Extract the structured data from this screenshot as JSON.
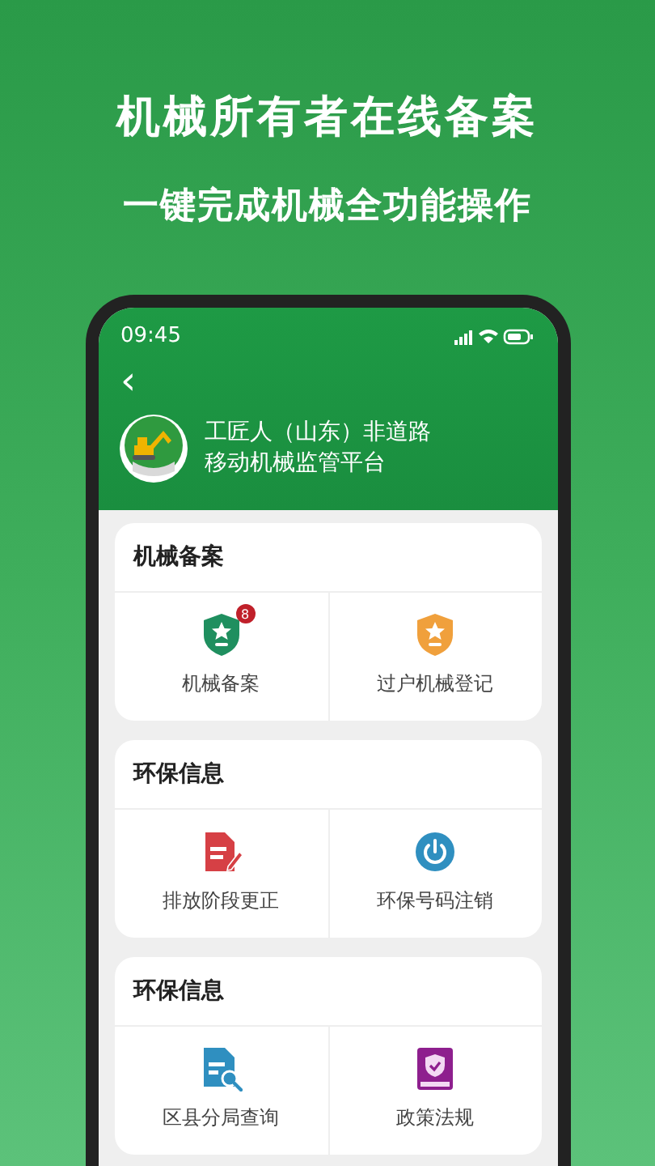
{
  "headline": "机械所有者在线备案",
  "subheadline": "一键完成机械全功能操作",
  "phone": {
    "status_bar": {
      "time": "09:45"
    },
    "header": {
      "back": "‹",
      "title_lines": [
        "工匠人（山东）非道路",
        "移动机械监管平台"
      ]
    },
    "sections": [
      {
        "title": "机械备案",
        "items": [
          {
            "kind": "shield-green",
            "label": "机械备案",
            "badge": "8"
          },
          {
            "kind": "shield-orange",
            "label": "过户机械登记"
          }
        ]
      },
      {
        "title": "环保信息",
        "items": [
          {
            "kind": "doc-edit",
            "label": "排放阶段更正"
          },
          {
            "kind": "power",
            "label": "环保号码注销"
          }
        ]
      },
      {
        "title": "环保信息",
        "items": [
          {
            "kind": "doc-search",
            "label": "区县分局查询"
          },
          {
            "kind": "book",
            "label": "政策法规"
          }
        ]
      }
    ]
  }
}
